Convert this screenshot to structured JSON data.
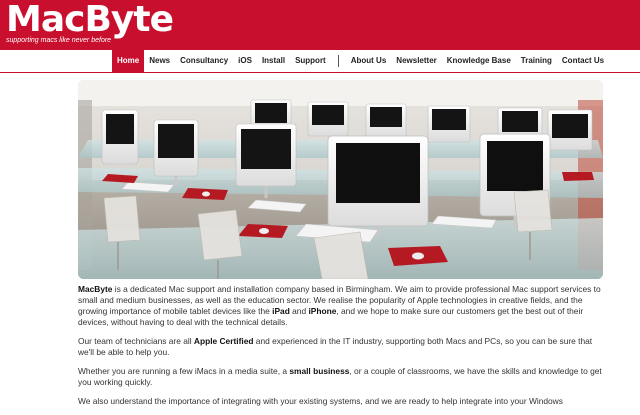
{
  "header": {
    "title": "MacByte",
    "tagline": "supporting macs like never before"
  },
  "nav": {
    "left": [
      "Home",
      "News",
      "Consultancy",
      "iOS",
      "Install",
      "Support"
    ],
    "right": [
      "About Us",
      "Newsletter",
      "Knowledge Base",
      "Training",
      "Contact Us"
    ],
    "active": "Home"
  },
  "hero": {
    "description": "Computer classroom with rows of white iMacs on glass desks with red mouse mats and keyboards"
  },
  "intro": {
    "p1": {
      "a": "MacByte",
      "b": " is a dedicated Mac support and installation company based in Birmingham. We aim to provide professional Mac support services to small and medium businesses, as well as the education sector. We realise the popularity of Apple technologies in creative fields, and the growing importance of mobile tablet devices like the ",
      "c": "iPad",
      "d": " and ",
      "e": "iPhone",
      "f": ", and we hope to make sure our customers get the best out of their devices, without having to deal with the technical details."
    },
    "p2": {
      "a": "Our team of technicians are all ",
      "b": "Apple Certified",
      "c": " and experienced in the IT industry, supporting both Macs and PCs, so you can be sure that we'll be able to help you."
    },
    "p3": {
      "a": "Whether you are running a few iMacs in a media suite, a ",
      "b": "small business",
      "c": ", or a couple of classrooms, we have the skills and knowledge to get you working quickly."
    },
    "p4": {
      "a": "We also understand the importance of integrating with your existing systems, and we are ready to help integrate into your Windows"
    }
  },
  "colors": {
    "brand_red": "#c8102e",
    "nav_text": "#222222",
    "body_text": "#333333"
  }
}
